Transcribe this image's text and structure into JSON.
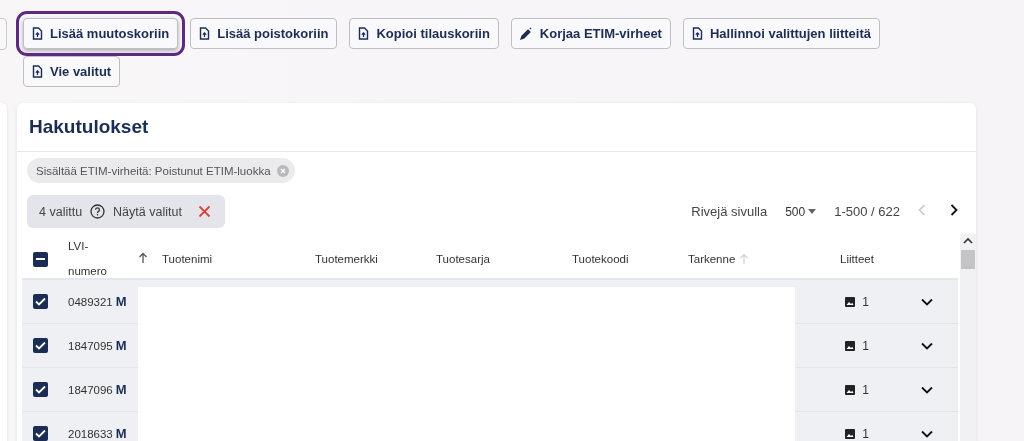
{
  "toolbar": {
    "buttons": [
      {
        "label": "Lisää muutoskoriin",
        "kind": "file",
        "focused": true
      },
      {
        "label": "Lisää poistokoriin",
        "kind": "file",
        "focused": false
      },
      {
        "label": "Kopioi tilauskoriin",
        "kind": "file",
        "focused": false
      },
      {
        "label": "Korjaa ETIM-virheet",
        "kind": "edit",
        "focused": false
      },
      {
        "label": "Hallinnoi valittujen liitteitä",
        "kind": "file",
        "focused": false
      },
      {
        "label": "Vie valitut",
        "kind": "file",
        "focused": false
      }
    ]
  },
  "results": {
    "title": "Hakutulokset",
    "filter_chips": [
      {
        "label": "Sisältää ETIM-virheitä: Poistunut ETIM-luokka"
      }
    ],
    "selection": {
      "count": "4 valittu",
      "show_selected": "Näytä valitut"
    },
    "pagination": {
      "rows_per_page_label": "Rivejä sivulla",
      "rows_per_page": "500",
      "range": "1-500 / 622",
      "prev_disabled": true,
      "next_disabled": false
    },
    "table": {
      "header_indeterminate": true,
      "columns": [
        {
          "label": "LVI-numero",
          "sorted": true,
          "faint_arrow": false
        },
        {
          "label": "Tuotenimi",
          "sorted": false,
          "faint_arrow": false
        },
        {
          "label": "Tuotemerkki",
          "sorted": false,
          "faint_arrow": false
        },
        {
          "label": "Tuotesarja",
          "sorted": false,
          "faint_arrow": false
        },
        {
          "label": "Tuotekoodi",
          "sorted": false,
          "faint_arrow": false
        },
        {
          "label": "Tarkenne",
          "sorted": false,
          "faint_arrow": true
        },
        {
          "label": "Liitteet",
          "sorted": false,
          "faint_arrow": false
        }
      ],
      "rows": [
        {
          "lvi": "0489321",
          "badge": "M",
          "attachments": "1",
          "checked": true
        },
        {
          "lvi": "1847095",
          "badge": "M",
          "attachments": "1",
          "checked": true
        },
        {
          "lvi": "1847096",
          "badge": "M",
          "attachments": "1",
          "checked": true
        },
        {
          "lvi": "2018633",
          "badge": "M",
          "attachments": "1",
          "checked": true
        }
      ]
    }
  }
}
